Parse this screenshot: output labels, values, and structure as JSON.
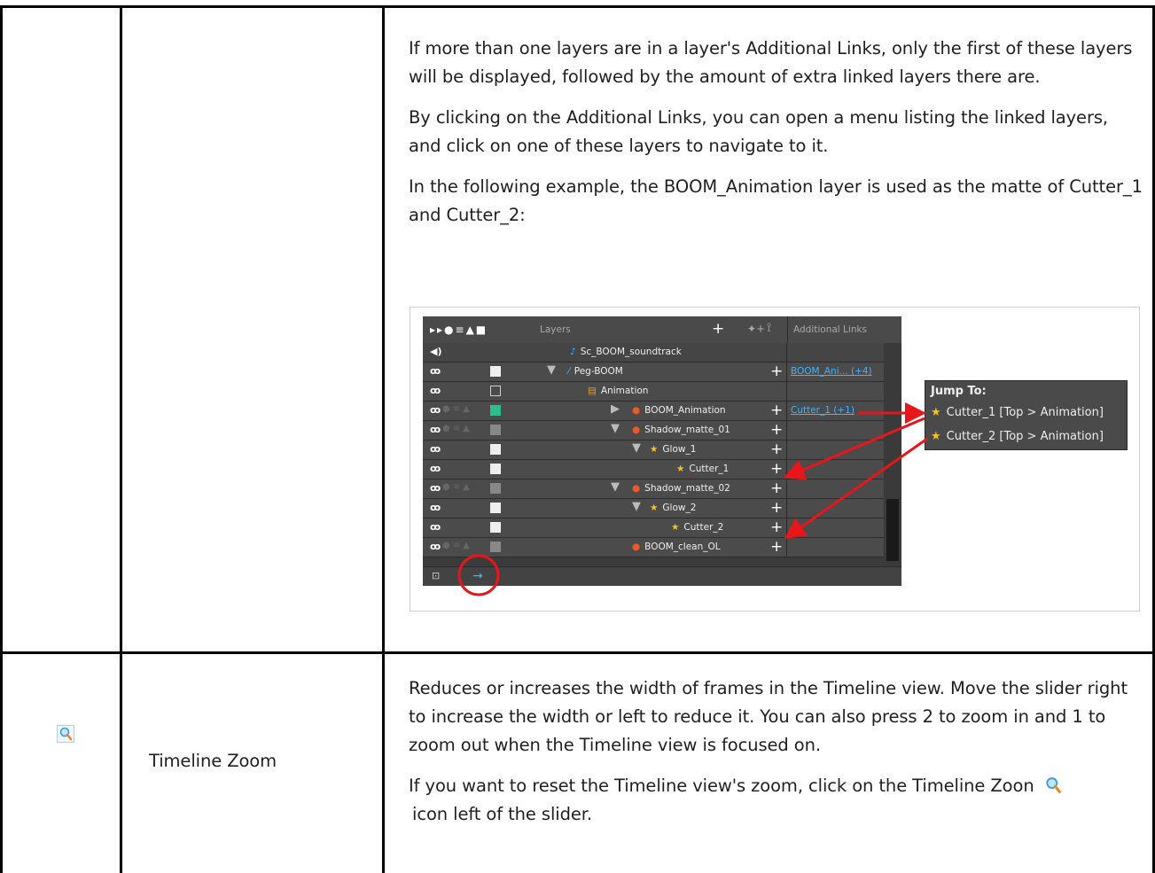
{
  "row1": {
    "paragraphs": [
      "If more than one layers are in a layer's Additional Links, only the first of these layers will be displayed, followed by the amount of extra linked layers there are.",
      "By clicking on the Additional Links, you can open a menu listing the linked layers, and click on one of these layers to navigate to it.",
      "In the following example, the BOOM_Animation layer is used as the matte of Cutter_1 and Cutter_2:"
    ],
    "screenshot": {
      "header_layers": "Layers",
      "header_additional_links": "Additional Links",
      "layers": [
        {
          "name": "Sc_BOOM_soundtrack",
          "link": ""
        },
        {
          "name": "Peg-BOOM",
          "link": "BOOM_Ani... (+4)"
        },
        {
          "name": "Animation",
          "link": ""
        },
        {
          "name": "BOOM_Animation",
          "link": "Cutter_1 (+1)"
        },
        {
          "name": "Shadow_matte_01",
          "link": ""
        },
        {
          "name": "Glow_1",
          "link": ""
        },
        {
          "name": "Cutter_1",
          "link": ""
        },
        {
          "name": "Shadow_matte_02",
          "link": ""
        },
        {
          "name": "Glow_2",
          "link": ""
        },
        {
          "name": "Cutter_2",
          "link": ""
        },
        {
          "name": "BOOM_clean_OL",
          "link": ""
        }
      ],
      "jump_menu": {
        "title": "Jump To:",
        "items": [
          "Cutter_1 [Top > Animation]",
          "Cutter_2 [Top > Animation]"
        ]
      }
    }
  },
  "row2": {
    "icon": "timeline-zoom-icon",
    "name": "Timeline Zoom",
    "paragraphs": [
      "Reduces or increases the width of frames in the Timeline view. Move the slider right to increase the width or left to reduce it. You can also press 2 to zoom in and 1 to zoom out when the Timeline view is focused on.",
      "If you want to reset the Timeline view's zoom, click on the Timeline Zoon",
      "icon left of the slider."
    ]
  },
  "colors": {
    "border": "#000000",
    "link_blue": "#3fb4ff",
    "callout_red": "#e8161b",
    "star": "#f7c21a"
  }
}
